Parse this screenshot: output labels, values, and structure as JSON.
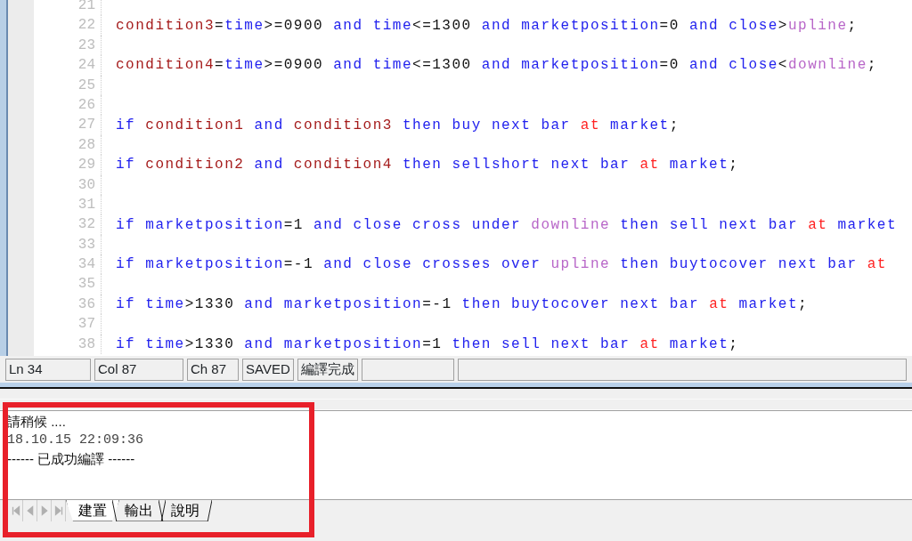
{
  "editor": {
    "lines": [
      {
        "number": "21"
      },
      {
        "number": "22",
        "tokens": [
          {
            "kind": "var",
            "text": "condition3"
          },
          {
            "kind": "plain",
            "text": "="
          },
          {
            "kind": "kw",
            "text": "time"
          },
          {
            "kind": "plain",
            "text": ">=0900"
          },
          {
            "kind": "kw",
            "text": " and time"
          },
          {
            "kind": "plain",
            "text": "<=1300"
          },
          {
            "kind": "kw",
            "text": " and marketposition"
          },
          {
            "kind": "plain",
            "text": "=0"
          },
          {
            "kind": "kw",
            "text": " and close"
          },
          {
            "kind": "plain",
            "text": ">"
          },
          {
            "kind": "user",
            "text": "upline"
          },
          {
            "kind": "plain",
            "text": ";"
          }
        ]
      },
      {
        "number": "23"
      },
      {
        "number": "24",
        "tokens": [
          {
            "kind": "var",
            "text": "condition4"
          },
          {
            "kind": "plain",
            "text": "="
          },
          {
            "kind": "kw",
            "text": "time"
          },
          {
            "kind": "plain",
            "text": ">=0900"
          },
          {
            "kind": "kw",
            "text": " and time"
          },
          {
            "kind": "plain",
            "text": "<=1300"
          },
          {
            "kind": "kw",
            "text": " and marketposition"
          },
          {
            "kind": "plain",
            "text": "=0"
          },
          {
            "kind": "kw",
            "text": " and close"
          },
          {
            "kind": "plain",
            "text": "<"
          },
          {
            "kind": "user",
            "text": "downline"
          },
          {
            "kind": "plain",
            "text": ";"
          }
        ]
      },
      {
        "number": "25"
      },
      {
        "number": "26"
      },
      {
        "number": "27",
        "tokens": [
          {
            "kind": "kw",
            "text": "if "
          },
          {
            "kind": "var",
            "text": "condition1"
          },
          {
            "kind": "kw",
            "text": " and "
          },
          {
            "kind": "var",
            "text": "condition3"
          },
          {
            "kind": "kw",
            "text": " then buy next bar "
          },
          {
            "kind": "res",
            "text": "at"
          },
          {
            "kind": "kw",
            "text": " market"
          },
          {
            "kind": "plain",
            "text": ";"
          }
        ]
      },
      {
        "number": "28"
      },
      {
        "number": "29",
        "tokens": [
          {
            "kind": "kw",
            "text": "if "
          },
          {
            "kind": "var",
            "text": "condition2"
          },
          {
            "kind": "kw",
            "text": " and "
          },
          {
            "kind": "var",
            "text": "condition4"
          },
          {
            "kind": "kw",
            "text": " then sellshort next bar "
          },
          {
            "kind": "res",
            "text": "at"
          },
          {
            "kind": "kw",
            "text": " market"
          },
          {
            "kind": "plain",
            "text": ";"
          }
        ]
      },
      {
        "number": "30"
      },
      {
        "number": "31"
      },
      {
        "number": "32",
        "tokens": [
          {
            "kind": "kw",
            "text": "if marketposition"
          },
          {
            "kind": "plain",
            "text": "=1"
          },
          {
            "kind": "kw",
            "text": " and close cross under "
          },
          {
            "kind": "user",
            "text": "downline"
          },
          {
            "kind": "kw",
            "text": " then sell next bar "
          },
          {
            "kind": "res",
            "text": "at"
          },
          {
            "kind": "kw",
            "text": " market"
          }
        ]
      },
      {
        "number": "33"
      },
      {
        "number": "34",
        "tokens": [
          {
            "kind": "kw",
            "text": "if marketposition"
          },
          {
            "kind": "plain",
            "text": "=-1"
          },
          {
            "kind": "kw",
            "text": " and close crosses over "
          },
          {
            "kind": "user",
            "text": "upline"
          },
          {
            "kind": "kw",
            "text": " then buytocover next bar "
          },
          {
            "kind": "res",
            "text": "at"
          }
        ]
      },
      {
        "number": "35"
      },
      {
        "number": "36",
        "tokens": [
          {
            "kind": "kw",
            "text": "if time"
          },
          {
            "kind": "plain",
            "text": ">1330"
          },
          {
            "kind": "kw",
            "text": " and marketposition"
          },
          {
            "kind": "plain",
            "text": "=-1"
          },
          {
            "kind": "kw",
            "text": " then buytocover next bar "
          },
          {
            "kind": "res",
            "text": "at"
          },
          {
            "kind": "kw",
            "text": " market"
          },
          {
            "kind": "plain",
            "text": ";"
          }
        ]
      },
      {
        "number": "37"
      },
      {
        "number": "38",
        "tokens": [
          {
            "kind": "kw",
            "text": "if time"
          },
          {
            "kind": "plain",
            "text": ">1330"
          },
          {
            "kind": "kw",
            "text": " and marketposition"
          },
          {
            "kind": "plain",
            "text": "=1"
          },
          {
            "kind": "kw",
            "text": " then sell next bar "
          },
          {
            "kind": "res",
            "text": "at"
          },
          {
            "kind": "kw",
            "text": " market"
          },
          {
            "kind": "plain",
            "text": ";"
          }
        ]
      }
    ]
  },
  "status_bar": [
    "Ln 34",
    "Col 87",
    "Ch 87",
    "SAVED",
    "編譯完成"
  ],
  "output": {
    "lines": [
      {
        "kind": "text",
        "text": "請稍候 ...."
      },
      {
        "kind": "mono",
        "text": "18.10.15 22:09:36"
      },
      {
        "kind": "text",
        "text": "------ 已成功編譯 ------"
      }
    ]
  },
  "tabs": [
    {
      "label": "建置",
      "selected": true
    },
    {
      "label": "輸出",
      "selected": false
    },
    {
      "label": "說明",
      "selected": false
    }
  ]
}
